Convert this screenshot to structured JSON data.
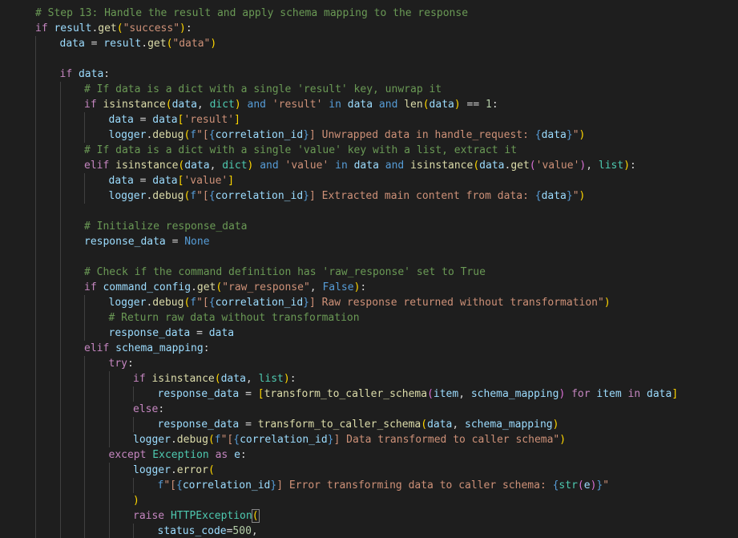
{
  "editor": {
    "lines": [
      [
        [
          "cmt",
          "# Step 13: Handle the result and apply schema mapping to the response"
        ]
      ],
      [
        [
          "kw",
          "if"
        ],
        [
          "plain",
          " "
        ],
        [
          "var",
          "result"
        ],
        [
          "plain",
          "."
        ],
        [
          "fn",
          "get"
        ],
        [
          "brk",
          "("
        ],
        [
          "str",
          "\"success\""
        ],
        [
          "brk",
          ")"
        ],
        [
          "plain",
          ":"
        ]
      ],
      [
        [
          "var",
          "data"
        ],
        [
          "plain",
          " = "
        ],
        [
          "var",
          "result"
        ],
        [
          "plain",
          "."
        ],
        [
          "fn",
          "get"
        ],
        [
          "brk",
          "("
        ],
        [
          "str",
          "\"data\""
        ],
        [
          "brk",
          ")"
        ]
      ],
      [],
      [
        [
          "kw",
          "if"
        ],
        [
          "plain",
          " "
        ],
        [
          "var",
          "data"
        ],
        [
          "plain",
          ":"
        ]
      ],
      [
        [
          "cmt",
          "# If data is a dict with a single 'result' key, unwrap it"
        ]
      ],
      [
        [
          "kw",
          "if"
        ],
        [
          "plain",
          " "
        ],
        [
          "fn",
          "isinstance"
        ],
        [
          "brk",
          "("
        ],
        [
          "var",
          "data"
        ],
        [
          "plain",
          ", "
        ],
        [
          "cls",
          "dict"
        ],
        [
          "brk",
          ")"
        ],
        [
          "plain",
          " "
        ],
        [
          "kwb",
          "and"
        ],
        [
          "plain",
          " "
        ],
        [
          "str",
          "'result'"
        ],
        [
          "plain",
          " "
        ],
        [
          "kwb",
          "in"
        ],
        [
          "plain",
          " "
        ],
        [
          "var",
          "data"
        ],
        [
          "plain",
          " "
        ],
        [
          "kwb",
          "and"
        ],
        [
          "plain",
          " "
        ],
        [
          "fn",
          "len"
        ],
        [
          "brk",
          "("
        ],
        [
          "var",
          "data"
        ],
        [
          "brk",
          ")"
        ],
        [
          "plain",
          " == "
        ],
        [
          "num",
          "1"
        ],
        [
          "plain",
          ":"
        ]
      ],
      [
        [
          "var",
          "data"
        ],
        [
          "plain",
          " = "
        ],
        [
          "var",
          "data"
        ],
        [
          "brk",
          "["
        ],
        [
          "str",
          "'result'"
        ],
        [
          "brk",
          "]"
        ]
      ],
      [
        [
          "var",
          "logger"
        ],
        [
          "plain",
          "."
        ],
        [
          "fn",
          "debug"
        ],
        [
          "brk",
          "("
        ],
        [
          "kwb",
          "f"
        ],
        [
          "str",
          "\"["
        ],
        [
          "brace",
          "{"
        ],
        [
          "var",
          "correlation_id"
        ],
        [
          "brace",
          "}"
        ],
        [
          "str",
          "] Unwrapped data in handle_request: "
        ],
        [
          "brace",
          "{"
        ],
        [
          "var",
          "data"
        ],
        [
          "brace",
          "}"
        ],
        [
          "str",
          "\""
        ],
        [
          "brk",
          ")"
        ]
      ],
      [
        [
          "cmt",
          "# If data is a dict with a single 'value' key with a list, extract it"
        ]
      ],
      [
        [
          "kw",
          "elif"
        ],
        [
          "plain",
          " "
        ],
        [
          "fn",
          "isinstance"
        ],
        [
          "brk",
          "("
        ],
        [
          "var",
          "data"
        ],
        [
          "plain",
          ", "
        ],
        [
          "cls",
          "dict"
        ],
        [
          "brk",
          ")"
        ],
        [
          "plain",
          " "
        ],
        [
          "kwb",
          "and"
        ],
        [
          "plain",
          " "
        ],
        [
          "str",
          "'value'"
        ],
        [
          "plain",
          " "
        ],
        [
          "kwb",
          "in"
        ],
        [
          "plain",
          " "
        ],
        [
          "var",
          "data"
        ],
        [
          "plain",
          " "
        ],
        [
          "kwb",
          "and"
        ],
        [
          "plain",
          " "
        ],
        [
          "fn",
          "isinstance"
        ],
        [
          "brk",
          "("
        ],
        [
          "var",
          "data"
        ],
        [
          "plain",
          "."
        ],
        [
          "fn",
          "get"
        ],
        [
          "brk2",
          "("
        ],
        [
          "str",
          "'value'"
        ],
        [
          "brk2",
          ")"
        ],
        [
          "plain",
          ", "
        ],
        [
          "cls",
          "list"
        ],
        [
          "brk",
          ")"
        ],
        [
          "plain",
          ":"
        ]
      ],
      [
        [
          "var",
          "data"
        ],
        [
          "plain",
          " = "
        ],
        [
          "var",
          "data"
        ],
        [
          "brk",
          "["
        ],
        [
          "str",
          "'value'"
        ],
        [
          "brk",
          "]"
        ]
      ],
      [
        [
          "var",
          "logger"
        ],
        [
          "plain",
          "."
        ],
        [
          "fn",
          "debug"
        ],
        [
          "brk",
          "("
        ],
        [
          "kwb",
          "f"
        ],
        [
          "str",
          "\"["
        ],
        [
          "brace",
          "{"
        ],
        [
          "var",
          "correlation_id"
        ],
        [
          "brace",
          "}"
        ],
        [
          "str",
          "] Extracted main content from data: "
        ],
        [
          "brace",
          "{"
        ],
        [
          "var",
          "data"
        ],
        [
          "brace",
          "}"
        ],
        [
          "str",
          "\""
        ],
        [
          "brk",
          ")"
        ]
      ],
      [],
      [
        [
          "cmt",
          "# Initialize response_data"
        ]
      ],
      [
        [
          "var",
          "response_data"
        ],
        [
          "plain",
          " = "
        ],
        [
          "kwb",
          "None"
        ]
      ],
      [],
      [
        [
          "cmt",
          "# Check if the command definition has 'raw_response' set to True"
        ]
      ],
      [
        [
          "kw",
          "if"
        ],
        [
          "plain",
          " "
        ],
        [
          "var",
          "command_config"
        ],
        [
          "plain",
          "."
        ],
        [
          "fn",
          "get"
        ],
        [
          "brk",
          "("
        ],
        [
          "str",
          "\"raw_response\""
        ],
        [
          "plain",
          ", "
        ],
        [
          "kwb",
          "False"
        ],
        [
          "brk",
          ")"
        ],
        [
          "plain",
          ":"
        ]
      ],
      [
        [
          "var",
          "logger"
        ],
        [
          "plain",
          "."
        ],
        [
          "fn",
          "debug"
        ],
        [
          "brk",
          "("
        ],
        [
          "kwb",
          "f"
        ],
        [
          "str",
          "\"["
        ],
        [
          "brace",
          "{"
        ],
        [
          "var",
          "correlation_id"
        ],
        [
          "brace",
          "}"
        ],
        [
          "str",
          "] Raw response returned without transformation\""
        ],
        [
          "brk",
          ")"
        ]
      ],
      [
        [
          "cmt",
          "# Return raw data without transformation"
        ]
      ],
      [
        [
          "var",
          "response_data"
        ],
        [
          "plain",
          " = "
        ],
        [
          "var",
          "data"
        ]
      ],
      [
        [
          "kw",
          "elif"
        ],
        [
          "plain",
          " "
        ],
        [
          "var",
          "schema_mapping"
        ],
        [
          "plain",
          ":"
        ]
      ],
      [
        [
          "kw",
          "try"
        ],
        [
          "plain",
          ":"
        ]
      ],
      [
        [
          "kw",
          "if"
        ],
        [
          "plain",
          " "
        ],
        [
          "fn",
          "isinstance"
        ],
        [
          "brk",
          "("
        ],
        [
          "var",
          "data"
        ],
        [
          "plain",
          ", "
        ],
        [
          "cls",
          "list"
        ],
        [
          "brk",
          ")"
        ],
        [
          "plain",
          ":"
        ]
      ],
      [
        [
          "var",
          "response_data"
        ],
        [
          "plain",
          " = "
        ],
        [
          "brk",
          "["
        ],
        [
          "fn",
          "transform_to_caller_schema"
        ],
        [
          "brk2",
          "("
        ],
        [
          "var",
          "item"
        ],
        [
          "plain",
          ", "
        ],
        [
          "var",
          "schema_mapping"
        ],
        [
          "brk2",
          ")"
        ],
        [
          "plain",
          " "
        ],
        [
          "kw",
          "for"
        ],
        [
          "plain",
          " "
        ],
        [
          "var",
          "item"
        ],
        [
          "plain",
          " "
        ],
        [
          "kw",
          "in"
        ],
        [
          "plain",
          " "
        ],
        [
          "var",
          "data"
        ],
        [
          "brk",
          "]"
        ]
      ],
      [
        [
          "kw",
          "else"
        ],
        [
          "plain",
          ":"
        ]
      ],
      [
        [
          "var",
          "response_data"
        ],
        [
          "plain",
          " = "
        ],
        [
          "fn",
          "transform_to_caller_schema"
        ],
        [
          "brk",
          "("
        ],
        [
          "var",
          "data"
        ],
        [
          "plain",
          ", "
        ],
        [
          "var",
          "schema_mapping"
        ],
        [
          "brk",
          ")"
        ]
      ],
      [
        [
          "var",
          "logger"
        ],
        [
          "plain",
          "."
        ],
        [
          "fn",
          "debug"
        ],
        [
          "brk",
          "("
        ],
        [
          "kwb",
          "f"
        ],
        [
          "str",
          "\"["
        ],
        [
          "brace",
          "{"
        ],
        [
          "var",
          "correlation_id"
        ],
        [
          "brace",
          "}"
        ],
        [
          "str",
          "] Data transformed to caller schema\""
        ],
        [
          "brk",
          ")"
        ]
      ],
      [
        [
          "kw",
          "except"
        ],
        [
          "plain",
          " "
        ],
        [
          "cls",
          "Exception"
        ],
        [
          "plain",
          " "
        ],
        [
          "kw",
          "as"
        ],
        [
          "plain",
          " "
        ],
        [
          "var",
          "e"
        ],
        [
          "plain",
          ":"
        ]
      ],
      [
        [
          "var",
          "logger"
        ],
        [
          "plain",
          "."
        ],
        [
          "fn",
          "error"
        ],
        [
          "brk",
          "("
        ]
      ],
      [
        [
          "kwb",
          "f"
        ],
        [
          "str",
          "\"["
        ],
        [
          "brace",
          "{"
        ],
        [
          "var",
          "correlation_id"
        ],
        [
          "brace",
          "}"
        ],
        [
          "str",
          "] Error transforming data to caller schema: "
        ],
        [
          "brace",
          "{"
        ],
        [
          "cls",
          "str"
        ],
        [
          "brk2",
          "("
        ],
        [
          "var",
          "e"
        ],
        [
          "brk2",
          ")"
        ],
        [
          "brace",
          "}"
        ],
        [
          "str",
          "\""
        ]
      ],
      [
        [
          "brk",
          ")"
        ]
      ],
      [
        [
          "kw",
          "raise"
        ],
        [
          "plain",
          " "
        ],
        [
          "cls",
          "HTTPException"
        ],
        [
          "brk",
          "("
        ]
      ],
      [
        [
          "var",
          "status_code"
        ],
        [
          "plain",
          "="
        ],
        [
          "num",
          "500"
        ],
        [
          "plain",
          ","
        ]
      ]
    ],
    "indents": [
      2,
      2,
      3,
      0,
      3,
      4,
      4,
      5,
      5,
      4,
      4,
      5,
      5,
      0,
      4,
      4,
      0,
      4,
      4,
      5,
      5,
      5,
      4,
      5,
      6,
      7,
      6,
      7,
      6,
      5,
      6,
      7,
      6,
      6,
      7
    ]
  }
}
